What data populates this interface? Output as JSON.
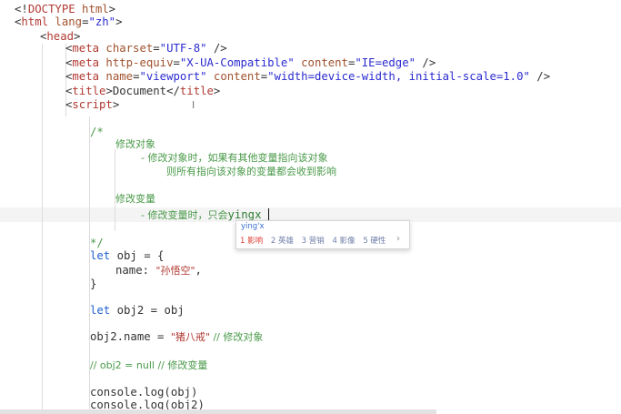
{
  "editor": {
    "doctype": {
      "open": "<!",
      "name": "DOCTYPE",
      "attr": " html",
      "close": ">"
    },
    "html_open": {
      "lt": "<",
      "tag": "html",
      "attr": " lang",
      "eq": "=",
      "val": "\"zh\"",
      "gt": ">"
    },
    "head_open": {
      "lt": "<",
      "tag": "head",
      "gt": ">"
    },
    "meta_charset": {
      "lt": "<",
      "tag": "meta",
      "attr": " charset",
      "eq": "=",
      "val": "\"UTF-8\"",
      "end": " />"
    },
    "meta_compat": {
      "lt": "<",
      "tag": "meta",
      "attr1": " http-equiv",
      "eq": "=",
      "val1": "\"X-UA-Compatible\"",
      "attr2": " content",
      "val2": "\"IE=edge\"",
      "end": " />"
    },
    "meta_viewport": {
      "lt": "<",
      "tag": "meta",
      "attr1": " name",
      "eq": "=",
      "val1": "\"viewport\"",
      "attr2": " content",
      "val2": "\"width=device-width, initial-scale=1.0\"",
      "end": " />"
    },
    "title_line": {
      "lt": "<",
      "tag": "title",
      "gt": ">",
      "text": "Document",
      "close_lt": "</",
      "close_tag": "title",
      "close_gt": ">"
    },
    "script_open": {
      "lt": "<",
      "tag": "script",
      "gt": ">"
    },
    "comment_open": "/*",
    "comment_lines": {
      "c1": "修改对象",
      "c2": "- 修改对象时，如果有其他变量指向该对象",
      "c3": "则所有指向该对象的变量都会收到影响",
      "c4": "修改变量",
      "c5": "- 修改变量时，只会",
      "c5_typed": "yingx"
    },
    "comment_close": "*/",
    "code": {
      "kw_let": "let",
      "obj_decl": " obj = {",
      "name_key": "name: ",
      "name_val": "\"孙悟空\"",
      "name_comma": ",",
      "close_brace": "}",
      "obj2_decl": " obj2 = obj",
      "assign": "obj2.name = ",
      "assign_val": "\"猪八戒\"",
      "assign_cm": " // 修改对象",
      "null_cm": "// obj2 = null // 修改变量",
      "log1": "console.log(obj)",
      "log2": "console.log(obj2)"
    }
  },
  "ime": {
    "pinyin": "ying'x",
    "candidates": [
      "1 影响",
      "2 英雄",
      "3 营销",
      "4 影像",
      "5 硬性"
    ],
    "more": "›"
  },
  "cursor_glyph": "I"
}
